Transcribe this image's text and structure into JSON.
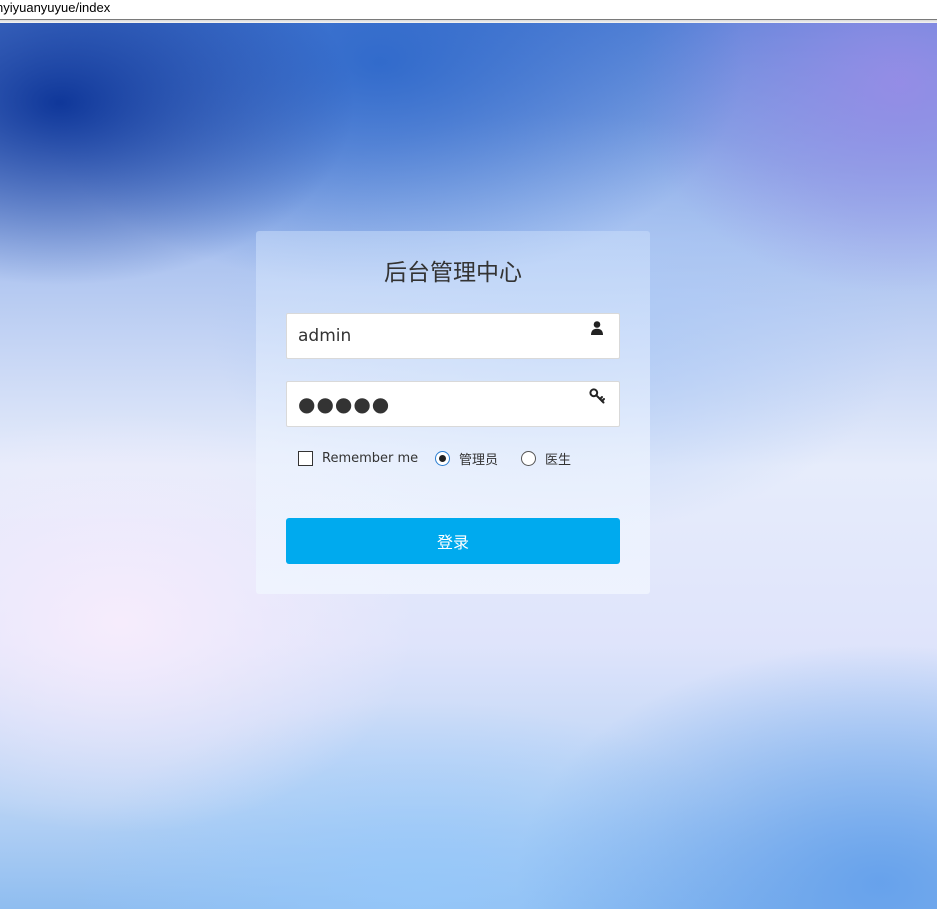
{
  "browser": {
    "url_fragment": "nyiyuanyuyue/index"
  },
  "login": {
    "title": "后台管理中心",
    "username_value": "admin",
    "password_value": "●●●●●",
    "remember_label": "Remember me",
    "remember_checked": false,
    "roles": [
      {
        "label": "管理员",
        "checked": true
      },
      {
        "label": "医生",
        "checked": false
      }
    ],
    "submit_label": "登录",
    "button_color": "#00aaee",
    "icons": {
      "username": "user-icon",
      "password": "key-icon"
    }
  }
}
